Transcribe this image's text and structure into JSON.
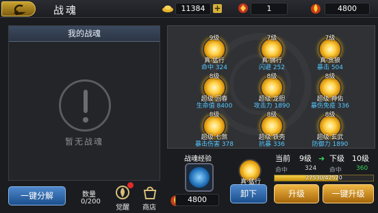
{
  "header": {
    "title": "战魂",
    "resources": [
      {
        "icon": "gold-ingot-icon",
        "value": "11384"
      },
      {
        "icon": "soul-token-icon",
        "value": "1"
      },
      {
        "icon": "flame-crystal-icon",
        "value": "4800"
      }
    ]
  },
  "left_panel": {
    "title": "我的战魂",
    "empty_text": "暂无战魂"
  },
  "souls": [
    {
      "level": "9级",
      "name": "真·猛行",
      "stat": "命中 324"
    },
    {
      "level": "7级",
      "name": "真·狮行",
      "stat": "闪避 252"
    },
    {
      "level": "7级",
      "name": "真·贪狼",
      "stat": "暴击 504"
    },
    {
      "level": "8级",
      "name": "超级·回春",
      "stat": "生命值 8400"
    },
    {
      "level": "8级",
      "name": "超级·龙胆",
      "stat": "攻击力 1890"
    },
    {
      "level": "8级",
      "name": "超级·神佑",
      "stat": "暴伤免疫 336"
    },
    {
      "level": "8级",
      "name": "超级·七煞",
      "stat": "暴击伤害 378"
    },
    {
      "level": "8级",
      "name": "超级·铁壳",
      "stat": "抗暴 336"
    },
    {
      "level": "8级",
      "name": "超级·玄武",
      "stat": "防御力 1890"
    }
  ],
  "detail": {
    "exp_label": "战魂经验",
    "selected_name": "真·猛行",
    "current_label": "当前",
    "current_level": "9级",
    "next_label": "下级",
    "next_level": "10级",
    "stat_name": "命中",
    "current_value": "324",
    "next_value": "360",
    "progress_text": "27530/42520",
    "progress_fraction": 0.647,
    "coin_value": "4800"
  },
  "buttons": {
    "one_click_decompose": "一键分解",
    "unload": "卸下",
    "upgrade": "升级",
    "one_click_upgrade": "一键升级"
  },
  "footer": {
    "count_label": "数量",
    "count_value": "0/200",
    "awaken_label": "觉醒",
    "shop_label": "商店"
  },
  "colors": {
    "accent_gold": "#d7b13b",
    "stat_blue": "#56c8ff",
    "next_green": "#3ad15a"
  }
}
